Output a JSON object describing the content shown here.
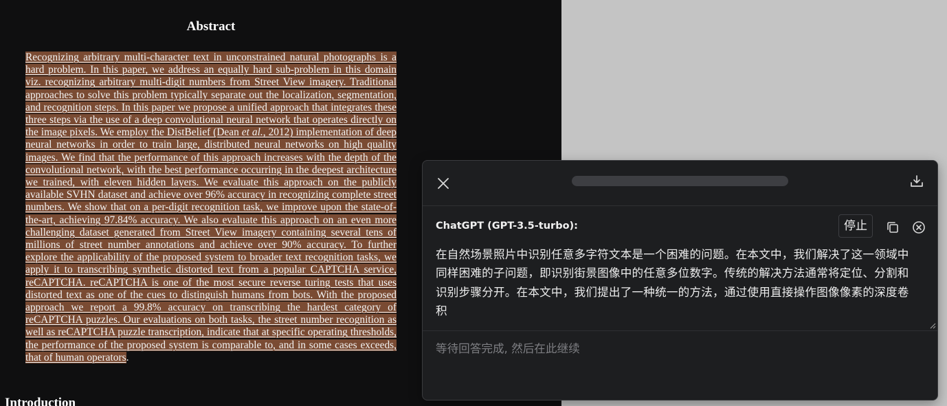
{
  "document": {
    "title": "Abstract",
    "abstract_part1": "Recognizing arbitrary multi-character text in unconstrained natural photographs is a hard problem. In this paper, we address an equally hard sub-problem in this domain viz. recognizing arbitrary multi-digit numbers from Street View imagery. Traditional approaches to solve this problem typically separate out the localization, segmentation, and recognition steps. In this paper we propose a unified approach that integrates these three steps via the use of a deep convolutional neural network that operates directly on the image pixels. We employ the DistBelief (Dean ",
    "abstract_etal": "et al.",
    "abstract_part2": ", 2012) implementation of deep neural networks in order to train large, distributed neural networks on high quality images. We find that the performance of this approach increases with the depth of the convolutional network, with the best performance occurring in the deepest architecture we trained, with eleven hidden layers. We evaluate this approach on the publicly available SVHN dataset and achieve over 96% accuracy in recognizing complete street numbers. We show that on a per-digit recognition task, we improve upon the state-of-the-art, achieving 97.84% accuracy. We also evaluate this approach on an even more challenging dataset generated from Street View imagery containing several tens of millions of street number annotations and achieve over 90% accuracy. To further explore the applicability of the proposed system to broader text recognition tasks, we apply it to transcribing synthetic distorted text from a popular CAPTCHA service, reCAPTCHA. reCAPTCHA is one of the most secure reverse turing tests that uses distorted text as one of the cues to distinguish humans from bots. With the proposed approach we report a 99.8% accuracy on transcribing the hardest category of reCAPTCHA puzzles. Our evaluations on both tasks, the street number recognition as well as reCAPTCHA puzzle transcription, indicate that at specific operating thresholds, the performance of the proposed system is comparable to, and in some cases exceeds, that of human operators",
    "abstract_end": ".",
    "next_heading": "Introduction"
  },
  "panel": {
    "model_label": "ChatGPT (GPT-3.5-turbo):",
    "stop_label": "停止",
    "response_text": "在自然场景照片中识别任意多字符文本是一个困难的问题。在本文中，我们解决了这一领域中同样困难的子问题，即识别街景图像中的任意多位数字。传统的解决方法通常将定位、分割和识别步骤分开。在本文中，我们提出了一种统一的方法，通过使用直接操作图像像素的深度卷积",
    "input_placeholder": "等待回答完成, 然后在此继续",
    "icons": [
      "close-icon",
      "download-icon",
      "copy-icon",
      "dismiss-circle-icon",
      "resize-grip-icon"
    ]
  },
  "colors": {
    "page_bg": "#c4c4c4",
    "doc_bg": "#0f0f10",
    "highlight": "#7a4b33",
    "panel_bg": "#1d1e20"
  }
}
